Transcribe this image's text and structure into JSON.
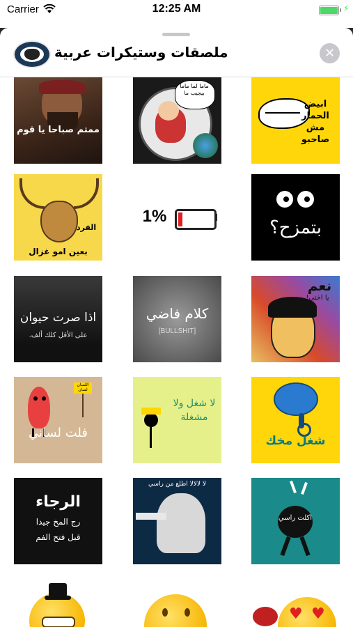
{
  "status_bar": {
    "carrier": "Carrier",
    "time": "12:25 AM"
  },
  "header": {
    "title": "ملصقات وستيكرات عربية",
    "close_label": "✕"
  },
  "stickers": [
    {
      "name": "sticker-good-morning",
      "caption": "ممتم صباحا يا قوم"
    },
    {
      "name": "sticker-astronaut",
      "caption": "ماما لما ماما بيجيب ما"
    },
    {
      "name": "sticker-camel",
      "caption": "ابيض الحمار مش صاحبو"
    },
    {
      "name": "sticker-deer",
      "caption_top": "الفرد",
      "caption": "بعين امو غزال"
    },
    {
      "name": "sticker-battery",
      "caption": "1%"
    },
    {
      "name": "sticker-eyes",
      "caption": "بتمزح؟"
    },
    {
      "name": "sticker-animal",
      "caption": "اذا صرت حيوان",
      "caption2": "على الأقل كلك ألف."
    },
    {
      "name": "sticker-bullshit",
      "caption": "كلام فاضي",
      "caption2": "[BULLSHIT]"
    },
    {
      "name": "sticker-naam",
      "caption": "نعم",
      "caption2": "يا اختي!"
    },
    {
      "name": "sticker-tongue",
      "caption": "فلت لساني",
      "sign": "اللسان لسان"
    },
    {
      "name": "sticker-shughl",
      "caption": "لا شغل ولا مشغلة"
    },
    {
      "name": "sticker-brain",
      "caption": "شغل مخك"
    },
    {
      "name": "sticker-please",
      "caption": "الرجاء",
      "caption2": "رج المخ جيدا",
      "caption3": "قبل فتح الفم"
    },
    {
      "name": "sticker-head",
      "caption": "لا لالالا اطلع من راسي"
    },
    {
      "name": "sticker-walking",
      "caption": "اكلت راسي"
    },
    {
      "name": "sticker-emoji-hat",
      "caption": ""
    },
    {
      "name": "sticker-emoji-eating",
      "caption": ""
    },
    {
      "name": "sticker-emoji-hearts",
      "caption": ""
    }
  ]
}
